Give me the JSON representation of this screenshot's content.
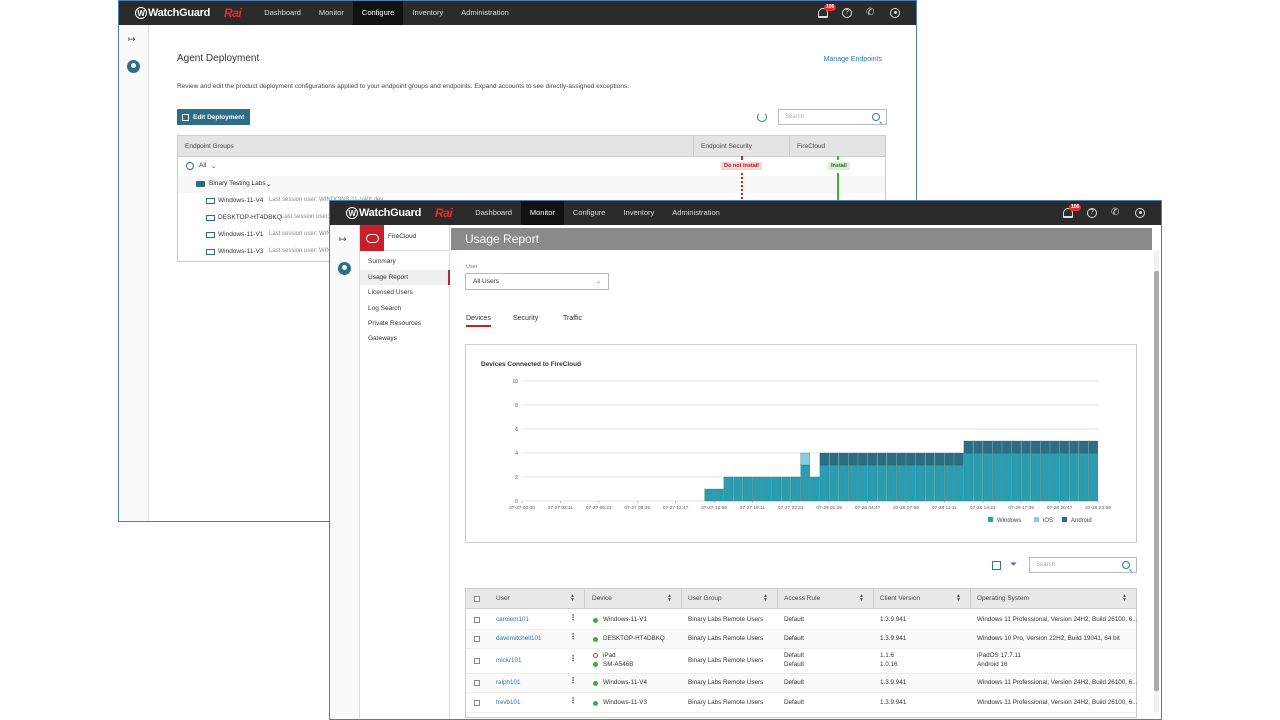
{
  "brand": {
    "logo": "WatchGuard",
    "product": "Rai"
  },
  "nav": [
    "Dashboard",
    "Monitor",
    "Configure",
    "Inventory",
    "Administration"
  ],
  "notifications": "106",
  "back_window": {
    "title": "Agent Deployment",
    "manage_link": "Manage Endpoints",
    "description": "Review and edit the product deployment configurations applied to your endpoint groups and endpoints. Expand accounts to see directly-assigned exceptions.",
    "edit_button": "Edit Deployment",
    "search_placeholder": "Search",
    "columns": [
      "Endpoint Groups",
      "Endpoint Security",
      "FireCloud"
    ],
    "rows": [
      {
        "name": "All"
      },
      {
        "name": "Binary Testing Labs"
      },
      {
        "name": "Windows-11-V4",
        "detail": "Last session user: WINDOWS-11-V4\\tt.dev"
      },
      {
        "name": "DESKTOP-HT4DBKQ",
        "detail": "Last session user:"
      },
      {
        "name": "Windows-11-V1",
        "detail": "Last session user: WIN"
      },
      {
        "name": "Windows-11-V3",
        "detail": "Last session user: WIN"
      }
    ],
    "tags": {
      "endpoint_security": "Do not install",
      "firecloud": "Install"
    }
  },
  "front_window": {
    "panel_title": "FireCloud",
    "menu": [
      "Summary",
      "Usage Report",
      "Licensed Users",
      "Log Search",
      "Private Resources",
      "Gateways"
    ],
    "page_title": "Usage Report",
    "user_label": "User",
    "user_select": "All Users",
    "tabs": [
      "Devices",
      "Security",
      "Traffic"
    ],
    "table_search_placeholder": "Search",
    "columns": [
      "User",
      "Device",
      "User Group",
      "Access Rule",
      "Client Version",
      "Operating System"
    ],
    "rows": [
      {
        "user": "carolem101",
        "devices": [
          "Windows-11-V1"
        ],
        "status": [
          "ok"
        ],
        "group": "Binary Labs Remote Users",
        "rule": [
          "Default"
        ],
        "version": [
          "1.3.9.941"
        ],
        "os": [
          "Windows 11 Professional, Version 24H2, Build 26100, 6..."
        ]
      },
      {
        "user": "davemitchell101",
        "devices": [
          "DESKTOP-HT4DBKQ"
        ],
        "status": [
          "ok"
        ],
        "group": "Binary Labs Remote Users",
        "rule": [
          "Default"
        ],
        "version": [
          "1.3.9.941"
        ],
        "os": [
          "Windows 10 Pro, Version 22H2, Build 19041, 64 bit"
        ]
      },
      {
        "user": "mickr101",
        "devices": [
          "iPad",
          "SM-A546B"
        ],
        "status": [
          "error",
          "ok"
        ],
        "group": "Binary Labs Remote Users",
        "rule": [
          "Default",
          "Default"
        ],
        "version": [
          "1.1.6",
          "1.0.16"
        ],
        "os": [
          "iPadOS 17.7.11",
          "Android 16"
        ]
      },
      {
        "user": "ralph101",
        "devices": [
          "Windows-11-V4"
        ],
        "status": [
          "ok"
        ],
        "group": "Binary Labs Remote Users",
        "rule": [
          "Default"
        ],
        "version": [
          "1.3.9.941"
        ],
        "os": [
          "Windows 11 Professional, Version 24H2, Build 26100, 6..."
        ]
      },
      {
        "user": "trevb101",
        "devices": [
          "Windows-11-V3"
        ],
        "status": [
          "ok"
        ],
        "group": "Binary Labs Remote Users",
        "rule": [
          "Default"
        ],
        "version": [
          "1.3.9.941"
        ],
        "os": [
          "Windows 11 Professional, Version 24H2, Build 26100, 6..."
        ]
      }
    ]
  },
  "colors": {
    "windows": "#2a9db0",
    "ios": "#86cfdc",
    "android": "#2c6d82",
    "accent": "#c8202a",
    "button": "#2d6e87"
  },
  "chart_data": {
    "type": "bar",
    "stacked": true,
    "title": "Devices Connected to FireCloud",
    "ylim": [
      0,
      10
    ],
    "yticks": [
      0,
      2,
      4,
      6,
      8,
      10
    ],
    "xtick_labels": [
      "07-27 00:00",
      "07-27 03:11",
      "07-27 06:23",
      "07-27 09:35",
      "07-27 12:47",
      "07-27 15:59",
      "07-27 19:11",
      "07-27 22:23",
      "07-28 01:35",
      "07-28 04:47",
      "07-28 07:59",
      "07-28 11:11",
      "07-28 14:23",
      "07-28 17:35",
      "07-28 20:47",
      "07-28 23:59"
    ],
    "legend": [
      "Windows",
      "iOS",
      "Android"
    ],
    "legend_position": "bottom-right",
    "bin_count": 60,
    "series": [
      {
        "name": "Windows",
        "values": [
          0,
          0,
          0,
          0,
          0,
          0,
          0,
          0,
          0,
          0,
          0,
          0,
          0,
          0,
          0,
          0,
          0,
          0,
          0,
          1,
          1,
          2,
          2,
          2,
          2,
          2,
          2,
          2,
          2,
          3,
          2,
          3,
          3,
          3,
          3,
          3,
          3,
          3,
          3,
          3,
          3,
          3,
          3,
          3,
          3,
          3,
          4,
          4,
          4,
          4,
          4,
          4,
          4,
          4,
          4,
          4,
          4,
          4,
          4,
          4
        ]
      },
      {
        "name": "iOS",
        "values": [
          0,
          0,
          0,
          0,
          0,
          0,
          0,
          0,
          0,
          0,
          0,
          0,
          0,
          0,
          0,
          0,
          0,
          0,
          0,
          0,
          0,
          0,
          0,
          0,
          0,
          0,
          0,
          0,
          0,
          1,
          0,
          0,
          0,
          0,
          0,
          0,
          0,
          0,
          0,
          0,
          0,
          0,
          0,
          0,
          0,
          0,
          0,
          0,
          0,
          0,
          0,
          0,
          0,
          0,
          0,
          0,
          0,
          0,
          0,
          0
        ]
      },
      {
        "name": "Android",
        "values": [
          0,
          0,
          0,
          0,
          0,
          0,
          0,
          0,
          0,
          0,
          0,
          0,
          0,
          0,
          0,
          0,
          0,
          0,
          0,
          0,
          0,
          0,
          0,
          0,
          0,
          0,
          0,
          0,
          0,
          0,
          0,
          1,
          1,
          1,
          1,
          1,
          1,
          1,
          1,
          1,
          1,
          1,
          1,
          1,
          1,
          1,
          1,
          1,
          1,
          1,
          1,
          1,
          1,
          1,
          1,
          1,
          1,
          1,
          1,
          1
        ]
      }
    ]
  }
}
